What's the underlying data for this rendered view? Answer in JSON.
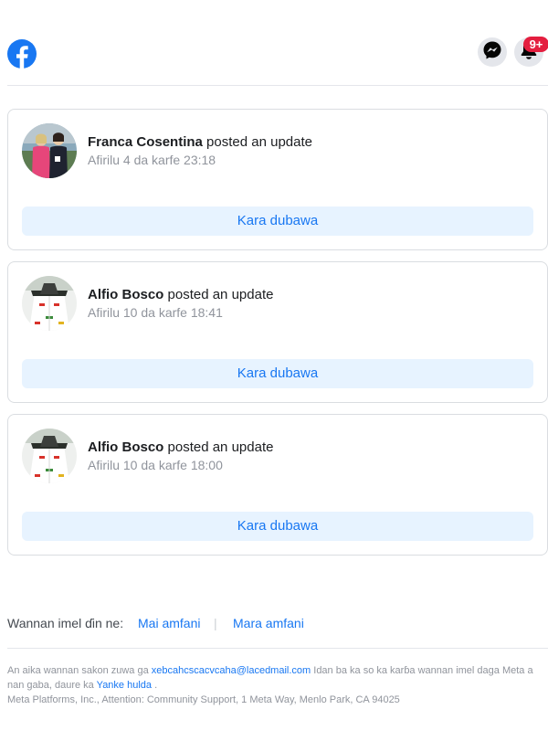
{
  "header": {
    "logo": "facebook-logo",
    "messenger_icon": "messenger-icon",
    "notifications_icon": "bell-icon",
    "notification_badge": "9+"
  },
  "posts": [
    {
      "name": "Franca Cosentina",
      "action": "posted an update",
      "time": "Afirilu 4 da karfe 23:18",
      "button": "Kara dubawa"
    },
    {
      "name": "Alfio Bosco",
      "action": "posted an update",
      "time": "Afirilu 10 da karfe 18:41",
      "button": "Kara dubawa"
    },
    {
      "name": "Alfio Bosco",
      "action": "posted an update",
      "time": "Afirilu 10 da karfe 18:00",
      "button": "Kara dubawa"
    }
  ],
  "preferences": {
    "label": "Wannan imel ɗin ne:",
    "option1": "Mai amfani",
    "separator": "|",
    "option2": "Mara amfani"
  },
  "footer": {
    "text1": "An aika wannan sakon zuwa ga ",
    "email": "xebcahcscacvcaha@lacedmail.com",
    "text2": " Idan ba ka so ka karɓa wannan imel daga Meta a nan gaba, daure ka ",
    "unsubscribe": "Yanke hulda",
    "text3": " .",
    "address": "Meta Platforms, Inc., Attention: Community Support, 1 Meta Way, Menlo Park, CA 94025"
  },
  "colors": {
    "brand": "#1877f2",
    "badge": "#e41e3f",
    "button_bg": "#e7f3ff"
  }
}
